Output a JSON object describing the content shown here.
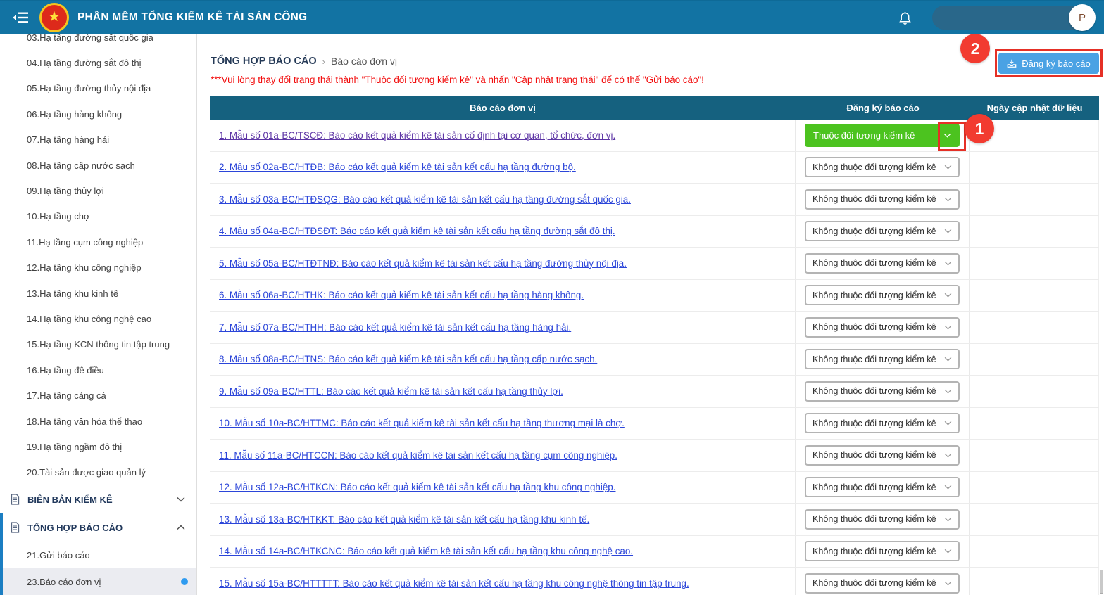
{
  "app": {
    "title": "PHẦN MỀM TỔNG KIỂM KÊ TÀI SẢN CÔNG",
    "avatar_letter": "P"
  },
  "sidebar": {
    "clipped_item": "03.Hạ tầng đường sắt quốc gia",
    "items": [
      "04.Hạ tầng đường sắt đô thị",
      "05.Hạ tầng đường thủy nội địa",
      "06.Hạ tầng hàng không",
      "07.Hạ tầng hàng hải",
      "08.Hạ tầng cấp nước sạch",
      "09.Hạ tầng thủy lợi",
      "10.Hạ tầng chợ",
      "11.Hạ tầng cụm công nghiệp",
      "12.Hạ tầng khu công nghiệp",
      "13.Hạ tầng khu kinh tế",
      "14.Hạ tầng khu công nghệ cao",
      "15.Hạ tầng KCN thông tin tập trung",
      "16.Hạ tầng đê điều",
      "17.Hạ tầng cảng cá",
      "18.Hạ tầng văn hóa thể thao",
      "19.Hạ tầng ngầm đô thị",
      "20.Tài sản được giao quản lý"
    ],
    "sections": [
      {
        "label": "BIÊN BẢN KIỂM KÊ"
      },
      {
        "label": "TỔNG HỢP BÁO CÁO",
        "children": [
          {
            "label": "21.Gửi báo cáo"
          },
          {
            "label": "23.Báo cáo đơn vị"
          }
        ]
      }
    ]
  },
  "breadcrumb": {
    "section": "TỔNG HỢP BÁO CÁO",
    "separator": "›",
    "page": "Báo cáo đơn vị"
  },
  "warning": "***Vui lòng thay đổi trạng thái thành \"Thuộc đối tượng kiểm kê\" và nhấn \"Cập nhật trạng thái\" để có thể \"Gửi báo cáo\"!",
  "toolbar": {
    "register_button": "Đăng ký báo cáo"
  },
  "table": {
    "columns": [
      "Báo cáo đơn vị",
      "Đăng ký báo cáo",
      "Ngày cập nhật dữ liệu"
    ],
    "rows": [
      {
        "report": "1. Mẫu số 01a-BC/TSCĐ: Báo cáo kết quả kiểm kê tài sản cố định tại cơ quan, tổ chức, đơn vị.",
        "status": "Thuộc đối tượng kiểm kê",
        "registered": "true",
        "updated": ""
      },
      {
        "report": "2. Mẫu số 02a-BC/HTĐB: Báo cáo kết quả kiểm kê tài sản kết cấu hạ tầng đường bộ.",
        "status": "Không thuộc đối tượng kiểm kê",
        "registered": "false",
        "updated": ""
      },
      {
        "report": "3. Mẫu số 03a-BC/HTĐSQG: Báo cáo kết quả kiểm kê tài sản kết cấu hạ tầng đường sắt quốc gia.",
        "status": "Không thuộc đối tượng kiểm kê",
        "registered": "false",
        "updated": ""
      },
      {
        "report": "4. Mẫu số 04a-BC/HTĐSĐT: Báo cáo kết quả kiểm kê tài sản kết cấu hạ tầng đường sắt đô thị.",
        "status": "Không thuộc đối tượng kiểm kê",
        "registered": "false",
        "updated": ""
      },
      {
        "report": "5. Mẫu số 05a-BC/HTĐTNĐ: Báo cáo kết quả kiểm kê tài sản kết cấu hạ tầng đường thủy nội địa.",
        "status": "Không thuộc đối tượng kiểm kê",
        "registered": "false",
        "updated": ""
      },
      {
        "report": "6. Mẫu số 06a-BC/HTHK: Báo cáo kết quả kiểm kê tài sản kết cấu hạ tầng hàng không.",
        "status": "Không thuộc đối tượng kiểm kê",
        "registered": "false",
        "updated": ""
      },
      {
        "report": "7. Mẫu số 07a-BC/HTHH: Báo cáo kết quả kiểm kê tài sản kết cấu hạ tầng hàng hải.",
        "status": "Không thuộc đối tượng kiểm kê",
        "registered": "false",
        "updated": ""
      },
      {
        "report": "8. Mẫu số 08a-BC/HTNS: Báo cáo kết quả kiểm kê tài sản kết cấu hạ tầng cấp nước sạch.",
        "status": "Không thuộc đối tượng kiểm kê",
        "registered": "false",
        "updated": ""
      },
      {
        "report": "9. Mẫu số 09a-BC/HTTL: Báo cáo kết quả kiểm kê tài sản kết cấu hạ tầng thủy lợi.",
        "status": "Không thuộc đối tượng kiểm kê",
        "registered": "false",
        "updated": ""
      },
      {
        "report": "10. Mẫu số 10a-BC/HTTMC: Báo cáo kết quả kiểm kê tài sản kết cấu hạ tầng thương mại là chợ.",
        "status": "Không thuộc đối tượng kiểm kê",
        "registered": "false",
        "updated": ""
      },
      {
        "report": "11. Mẫu số 11a-BC/HTCCN: Báo cáo kết quả kiểm kê tài sản kết cấu hạ tầng cụm công nghiệp.",
        "status": "Không thuộc đối tượng kiểm kê",
        "registered": "false",
        "updated": ""
      },
      {
        "report": "12. Mẫu số 12a-BC/HTKCN: Báo cáo kết quả kiểm kê tài sản kết cấu hạ tầng khu công nghiệp.",
        "status": "Không thuộc đối tượng kiểm kê",
        "registered": "false",
        "updated": ""
      },
      {
        "report": "13. Mẫu số 13a-BC/HTKKT: Báo cáo kết quả kiểm kê tài sản kết cấu hạ tầng khu kinh tế.",
        "status": "Không thuộc đối tượng kiểm kê",
        "registered": "false",
        "updated": ""
      },
      {
        "report": "14. Mẫu số 14a-BC/HTKCNC: Báo cáo kết quả kiểm kê tài sản kết cấu hạ tầng khu công nghệ cao.",
        "status": "Không thuộc đối tượng kiểm kê",
        "registered": "false",
        "updated": ""
      },
      {
        "report": "15. Mẫu số 15a-BC/HTTTTT: Báo cáo kết quả kiểm kê tài sản kết cấu hạ tầng khu công nghệ thông tin tập trung.",
        "status": "Không thuộc đối tượng kiểm kê",
        "registered": "false",
        "updated": ""
      }
    ]
  },
  "annotations": {
    "step1": "1",
    "step2": "2"
  },
  "colors": {
    "header_blue": "#1273a3",
    "table_header_teal": "#15617f",
    "registered_green": "#4cc31f",
    "annotation_red": "#e53026",
    "warning_red": "#f20d0d",
    "link_blue": "#2b45d9",
    "visited_link_purple": "#5d35a5",
    "active_dot_blue": "#2f9bf0"
  }
}
